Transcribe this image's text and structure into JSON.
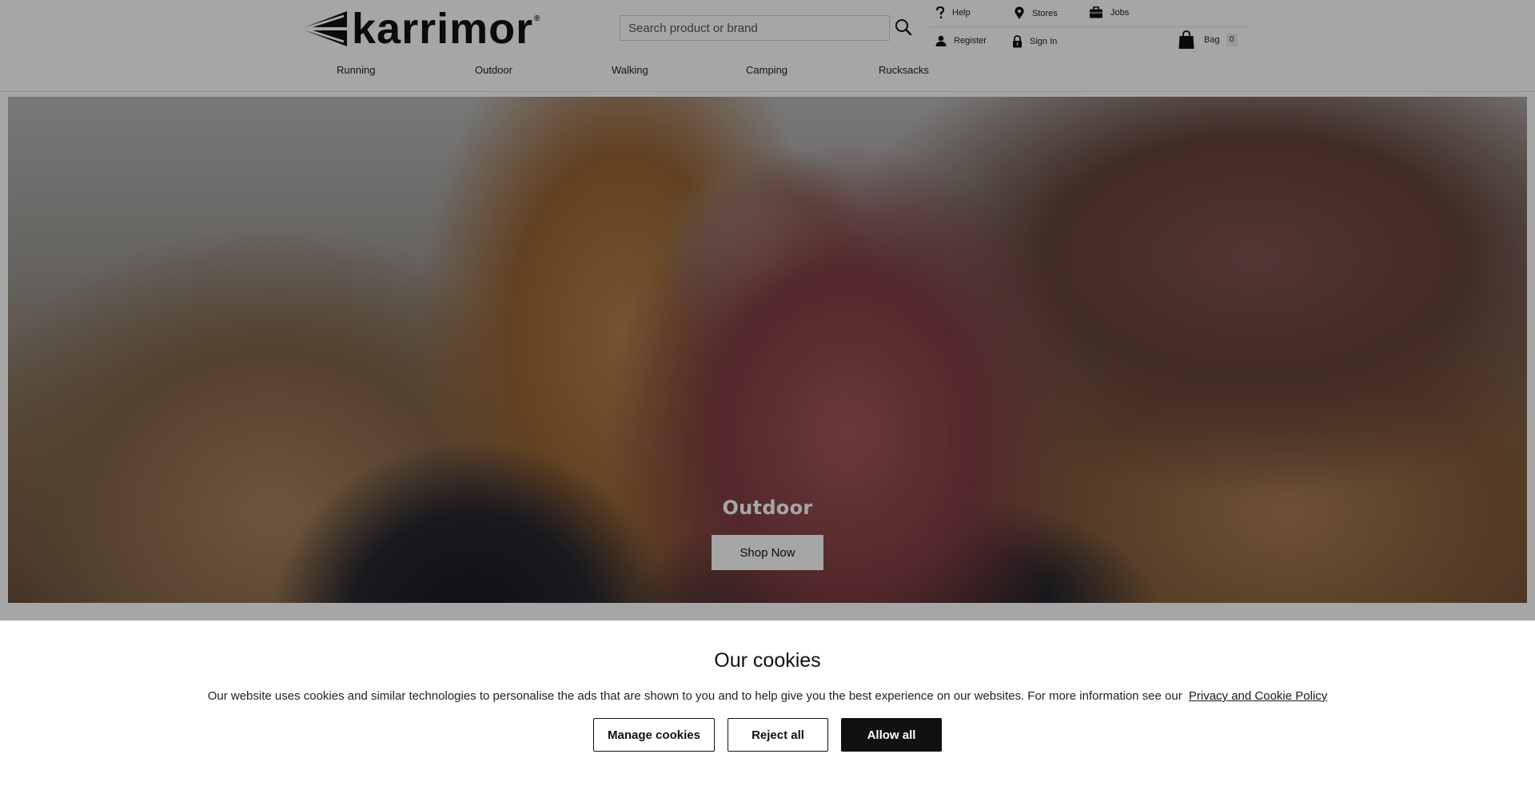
{
  "header": {
    "logo_text": "karrimor",
    "logo_mark": "®",
    "search": {
      "placeholder": "Search product or brand",
      "value": ""
    },
    "utility_links": {
      "help": "Help",
      "stores": "Stores",
      "jobs": "Jobs",
      "register": "Register",
      "sign_in": "Sign In"
    },
    "bag": {
      "label": "Bag",
      "count": "0"
    }
  },
  "nav": {
    "items": [
      {
        "label": "Running"
      },
      {
        "label": "Outdoor"
      },
      {
        "label": "Walking"
      },
      {
        "label": "Camping"
      },
      {
        "label": "Rucksacks"
      }
    ]
  },
  "hero": {
    "title": "Outdoor",
    "button_label": "Shop Now"
  },
  "cookie_banner": {
    "title": "Our cookies",
    "text": "Our website uses cookies and similar technologies to personalise the ads that are shown to you and to help give you the best experience on our websites. For more information see our",
    "link_text": "Privacy and Cookie Policy",
    "buttons": {
      "manage": "Manage cookies",
      "reject": "Reject all",
      "allow": "Allow all"
    }
  },
  "colors": {
    "button_dark": "#111111",
    "banner_background": "#ffffff",
    "overlay": "rgba(0,0,0,0.35)",
    "hero_jacket": "#b25f63"
  },
  "icons": [
    "search-icon",
    "help-icon",
    "location-pin-icon",
    "briefcase-icon",
    "user-icon",
    "lock-icon",
    "bag-icon",
    "karrimor-logo-mark"
  ]
}
